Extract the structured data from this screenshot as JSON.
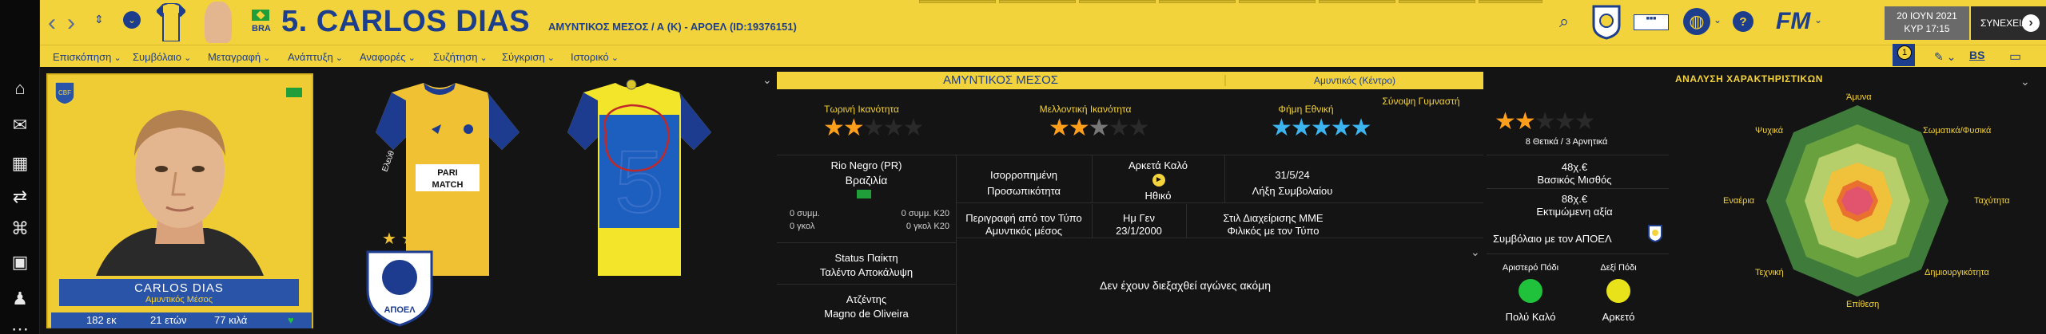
{
  "header": {
    "player_title": "5. CARLOS DIAS",
    "subtitle": "ΑΜΥΝΤΙΚΟΣ ΜΕΣΟΣ / Α (Κ) - ΑΡΟΕΛ (ID:19376151)",
    "nation": "BRA",
    "date": "20 ΙΟΥΝ 2021",
    "time": "ΚΥΡ 17:15",
    "continue_label": "ΣΥΝΕΧΕΙΑ",
    "brand": "FM",
    "icons": [
      "back-icon",
      "forward-icon",
      "history-icon",
      "dropdown-icon",
      "search-icon",
      "globe-icon",
      "help-icon",
      "fm-menu-icon",
      "notification-icon",
      "edit-icon",
      "bookmark-icon",
      "tv-icon"
    ],
    "badge_count": "1"
  },
  "menu": {
    "items": [
      "Επισκόπηση",
      "Συμβόλαιο",
      "Μεταγραφή",
      "Ανάπτυξη",
      "Αναφορές",
      "Συζήτηση",
      "Σύγκριση",
      "Ιστορικό"
    ]
  },
  "card": {
    "name": "CARLOS DIAS",
    "position": "Αμυντικός Μέσος",
    "height": "182 εκ",
    "age": "21 ετών",
    "weight": "77 κιλά"
  },
  "kits": {
    "home_sponsor_1": "PARI",
    "home_sponsor_2": "MATCH",
    "away_number": "5",
    "club_badge_text": "ΑΠΟΕΛ",
    "sleeve_text": "Ελεύθ"
  },
  "position_bar": {
    "role": "ΑΜΥΝΤΙΚΟΣ ΜΕΣΟΣ",
    "detail": "Αμυντικός (Κέντρο)"
  },
  "ratings": {
    "current_ability_label": "Τωρινή Ικανότητα",
    "potential_ability_label": "Μελλοντική Ικανότητα",
    "reputation_label": "Φήμη   Εθνική",
    "consensus_label": "Σύνοψη Γυμναστή",
    "current_ability_stars": 2,
    "potential_ability_stars": 2.5,
    "reputation_stars": 5,
    "consensus_stars": 2,
    "consensus_note": "8 Θετικά / 3 Αρνητικά"
  },
  "info": {
    "club": "Rio Negro (PR)",
    "country": "Βραζιλία",
    "caps_left": "0 συμμ.",
    "goals_left": "0 γκολ",
    "caps_right": "0 συμμ. Κ20",
    "goals_right": "0 γκολ Κ20",
    "personality": "Ισορροπημένη",
    "personality_label": "Προσωπικότητα",
    "morale": "Αρκετά Καλό",
    "morale_label": "Ηθικό",
    "contract_end": "31/5/24",
    "contract_end_label": "Λήξη Συμβολαίου",
    "wage": "48χ.€",
    "wage_label": "Βασικός Μισθός",
    "value": "88χ.€",
    "value_label": "Εκτιμώμενη αξία",
    "media_desc_label": "Περιγραφή από τον Τύπο",
    "media_desc": "Αμυντικός μέσος",
    "dob_label": "Ημ Γεν",
    "dob": "23/1/2000",
    "media_style_label": "Στιλ Διαχείρισης ΜΜΕ",
    "media_style": "Φιλικός με τον Τύπο",
    "status_label": "Status Παίκτη",
    "status": "Ταλέντο Αποκάλυψη",
    "agent_label": "Ατζέντης",
    "agent": "Magno de Oliveira",
    "contract_with": "Συμβόλαιο με τον ΑΠΟΕΛ",
    "no_matches": "Δεν έχουν διεξαχθεί αγώνες ακόμη",
    "left_foot_label": "Αριστερό Πόδι",
    "left_foot": "Πολύ Καλό",
    "right_foot_label": "Δεξί Πόδι",
    "right_foot": "Αρκετό",
    "left_foot_color": "#1fc23a",
    "right_foot_color": "#e8e21a"
  },
  "attributes": {
    "title": "ΑΝΑΛΥΣΗ ΧΑΡΑΚΤΗΡΙΣΤΙΚΩΝ",
    "labels": {
      "top": "Άμυνα",
      "top_right": "Σωματικά/Φυσικά",
      "right": "Ταχύτητα",
      "bottom_right": "Δημιουργικότητα",
      "bottom": "Επίθεση",
      "bottom_left": "Τεχνική",
      "left": "Εναέρια",
      "top_left": "Ψυχικά"
    }
  },
  "colors": {
    "accent_yellow": "#f3d33b",
    "club_blue": "#1c3e8c",
    "background": "#141414"
  }
}
